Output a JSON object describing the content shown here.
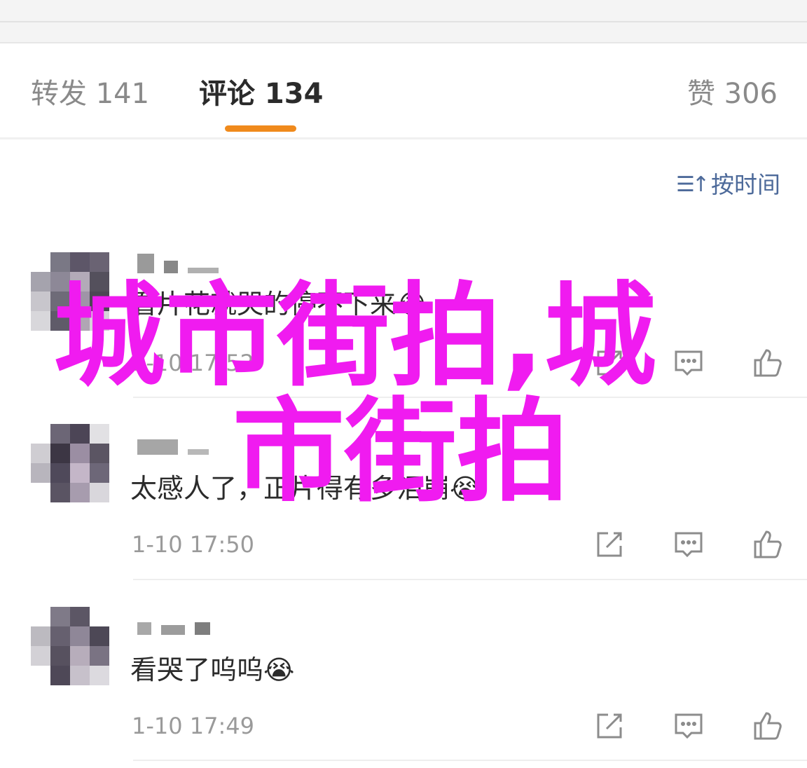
{
  "tabs": {
    "forward": "转发 141",
    "comment": "评论 134",
    "like": "赞 306"
  },
  "sort": {
    "icon": "sort-icon",
    "label": "按时间"
  },
  "comments": [
    {
      "text": "看片花就哭的停不下来😭",
      "time": "1-10 17:52"
    },
    {
      "text": "太感人了，正片得有多泪崩😭",
      "time": "1-10 17:50"
    },
    {
      "text": "看哭了呜呜😭",
      "time": "1-10 17:49"
    }
  ],
  "action_icons": [
    "share-icon",
    "reply-icon",
    "like-icon"
  ],
  "watermark": {
    "line1": "城市街拍,城",
    "line2": "市街拍"
  },
  "colors": {
    "accent": "#f08a1c",
    "link": "#4d6a9a",
    "watermark": "#f01bf0"
  }
}
